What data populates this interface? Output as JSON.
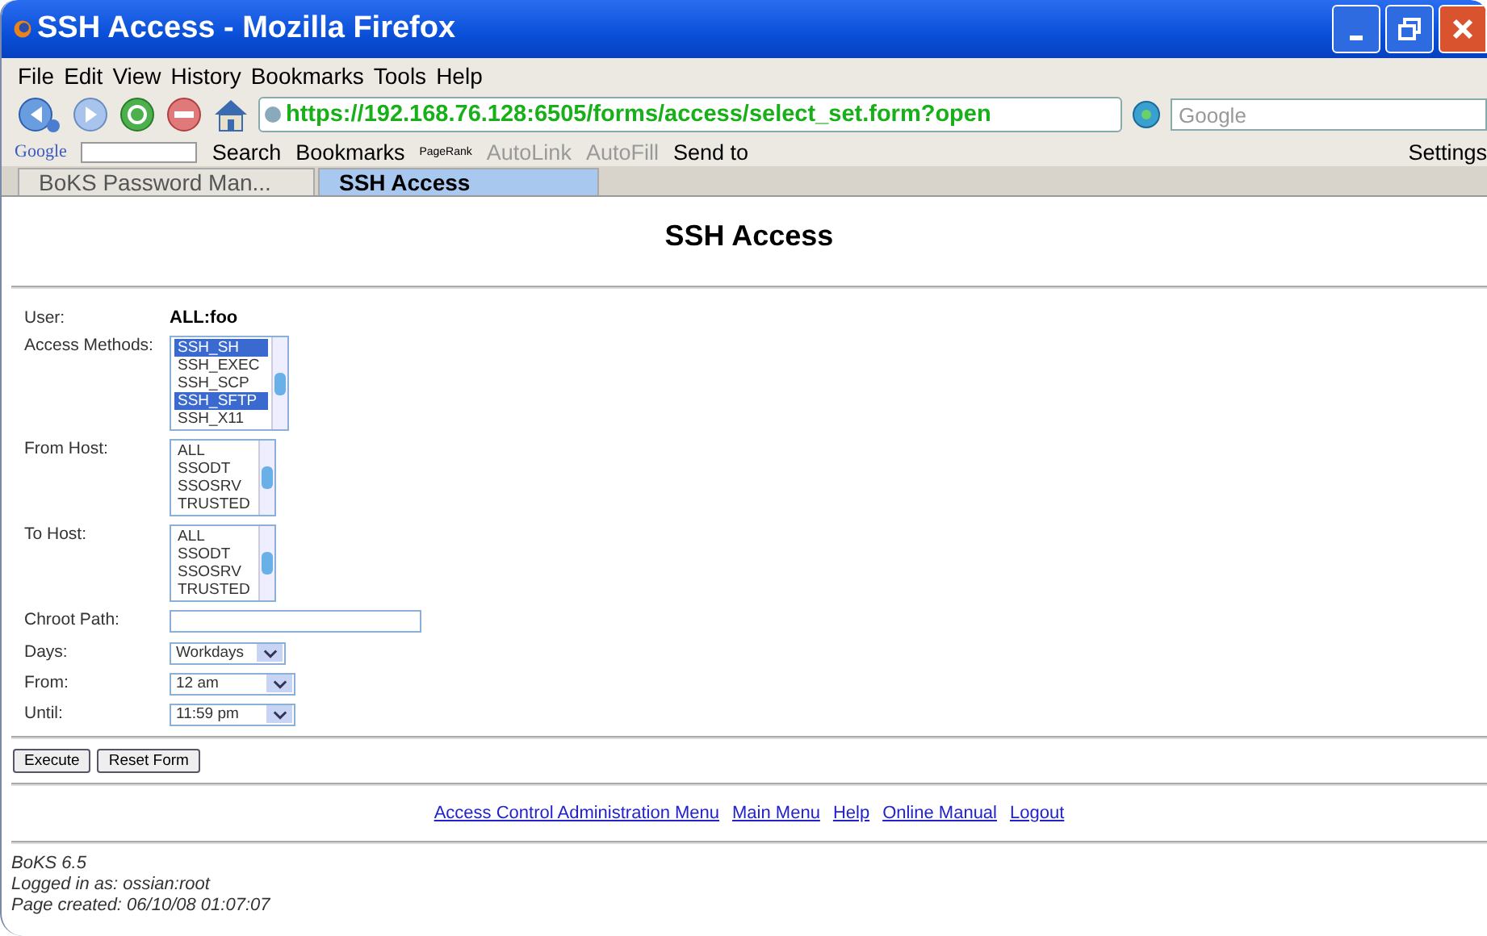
{
  "window": {
    "title": "SSH Access - Mozilla Firefox"
  },
  "menu": [
    "File",
    "Edit",
    "View",
    "History",
    "Bookmarks",
    "Tools",
    "Help"
  ],
  "address": {
    "value": "https://192.168.76.128:6505/forms/access/select_set.form?open"
  },
  "search": {
    "placeholder": "Google"
  },
  "google_toolbar": {
    "logo": "Google",
    "items": [
      {
        "label": "Search",
        "disabled": false
      },
      {
        "label": "Bookmarks",
        "disabled": false
      },
      {
        "label": "PageRank",
        "disabled": false
      },
      {
        "label": "AutoLink",
        "disabled": true
      },
      {
        "label": "AutoFill",
        "disabled": true
      },
      {
        "label": "Send to",
        "disabled": false
      }
    ],
    "settings": "Settings"
  },
  "tabs": [
    {
      "label": "BoKS Password Man...",
      "selected": false
    },
    {
      "label": "SSH Access",
      "selected": true
    }
  ],
  "page": {
    "heading": "SSH Access",
    "fields": [
      {
        "kind": "text",
        "label": "User:",
        "value": "ALL:foo"
      },
      {
        "kind": "listbox",
        "label": "Access Methods:",
        "options": [
          {
            "text": "SSH_SH",
            "selected": true
          },
          {
            "text": "SSH_EXEC",
            "selected": false
          },
          {
            "text": "SSH_SCP",
            "selected": false
          },
          {
            "text": "SSH_SFTP",
            "selected": true
          },
          {
            "text": "SSH_X11",
            "selected": false
          }
        ]
      },
      {
        "kind": "listbox",
        "label": "From Host:",
        "options": [
          {
            "text": "ALL",
            "selected": false
          },
          {
            "text": "SSODT",
            "selected": false
          },
          {
            "text": "SSOSRV",
            "selected": false
          },
          {
            "text": "TRUSTED",
            "selected": false
          }
        ]
      },
      {
        "kind": "listbox",
        "label": "To Host:",
        "options": [
          {
            "text": "ALL",
            "selected": false
          },
          {
            "text": "SSODT",
            "selected": false
          },
          {
            "text": "SSOSRV",
            "selected": false
          },
          {
            "text": "TRUSTED",
            "selected": false
          }
        ]
      },
      {
        "kind": "input",
        "label": "Chroot Path:"
      },
      {
        "kind": "select",
        "label": "Days:",
        "value": "Workdays"
      },
      {
        "kind": "select",
        "label": "From:",
        "value": "12 am"
      },
      {
        "kind": "select",
        "label": "Until:",
        "value": "11:59 pm"
      }
    ],
    "buttons": [
      "Execute",
      "Reset Form"
    ],
    "links": [
      "Access Control Administration Menu",
      "Main Menu",
      "Help",
      "Online Manual",
      "Logout"
    ],
    "footer": [
      "BoKS 6.5",
      "Logged in as: ossian:root",
      "Page created: 06/10/08 01:07:07"
    ]
  }
}
